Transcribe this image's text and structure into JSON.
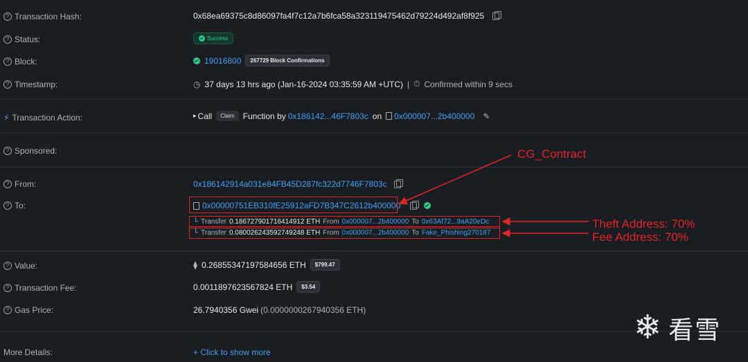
{
  "fields": {
    "tx_hash": {
      "label": "Transaction Hash:",
      "value": "0x68ea69375c8d86097fa4f7c12a7b6fca58a323119475462d79224d492af8f925"
    },
    "status": {
      "label": "Status:",
      "value": "Success"
    },
    "block": {
      "label": "Block:",
      "value": "19016800",
      "confirmations": "267729 Block Confirmations"
    },
    "timestamp": {
      "label": "Timestamp:",
      "value": "37 days 13 hrs ago (Jan-16-2024 03:35:59 AM +UTC)",
      "separator": "|",
      "confirmed": "Confirmed within 9 secs"
    },
    "action": {
      "label": "Transaction Action:",
      "call": "Call",
      "method": "Claim",
      "function_by": "Function by",
      "caller": "0x186142...46F7803c",
      "on": "on",
      "contract": "0x000007...2b400000"
    },
    "sponsored": {
      "label": "Sponsored:"
    },
    "from": {
      "label": "From:",
      "value": "0x186142914a031e84FB45D287fc322d7746F7803c"
    },
    "to": {
      "label": "To:",
      "value": "0x00000751EB310fE25912aFD7B347C2612b400000"
    },
    "transfers": [
      {
        "prefix": "Transfer",
        "amount": "0.186727901716414912 ETH",
        "from_label": "From",
        "from": "0x000007...2b400000",
        "to_label": "To",
        "to": "0x63Af72...9aA20eDc"
      },
      {
        "prefix": "Transfer",
        "amount": "0.080026243592749248 ETH",
        "from_label": "From",
        "from": "0x000007...2b400000",
        "to_label": "To",
        "to": "Fake_Phishing270187"
      }
    ],
    "value": {
      "label": "Value:",
      "amount": "0.26855347197584656 ETH",
      "usd": "$799.47"
    },
    "fee": {
      "label": "Transaction Fee:",
      "amount": "0.0011897623567824 ETH",
      "usd": "$3.54"
    },
    "gas": {
      "label": "Gas Price:",
      "gwei": "26.7940356 Gwei",
      "eth": "(0.0000000267940356 ETH)"
    },
    "more": {
      "label": "More Details:",
      "link": "+ Click to show more"
    }
  },
  "annotations": {
    "contract": "CG_Contract",
    "theft": "Theft Address: 70%",
    "fee": "Fee Address: 70%",
    "color": "#e02424"
  },
  "watermark": {
    "text": "看雪"
  },
  "colors": {
    "background": "#1a1d22",
    "link": "#3ea1f2",
    "success": "#2ecc8f"
  }
}
